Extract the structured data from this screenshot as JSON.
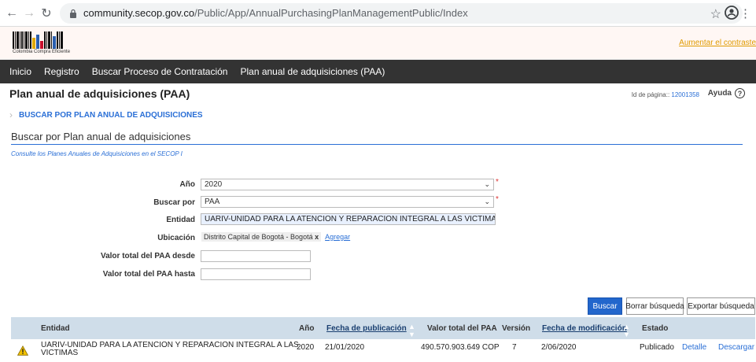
{
  "browser": {
    "back_icon": "arrow-left-icon",
    "forward_icon": "arrow-right-icon",
    "reload_icon": "reload-icon",
    "url_host": "community.secop.gov.co",
    "url_path": "/Public/App/AnnualPurchasingPlanManagementPublic/Index"
  },
  "header": {
    "logo_text": "Colombia Compra Eficiente",
    "font_size_link": "Aumentar el contraste"
  },
  "nav": {
    "items": [
      "Inicio",
      "Registro",
      "Buscar Proceso de Contratación",
      "Plan anual de adquisiciones (PAA)"
    ]
  },
  "page": {
    "title": "Plan anual de adquisiciones (PAA)",
    "page_id_label": "Id de página::",
    "page_id": "12001358",
    "help_label": "Ayuda",
    "breadcrumb": "BUSCAR POR PLAN ANUAL DE ADQUISICIONES",
    "section_title": "Buscar por Plan anual de adquisiciones",
    "subtitle": "Consulte los Planes Anuales de Adquisiciones en el SECOP I"
  },
  "form": {
    "year_label": "Año",
    "year_value": "2020",
    "search_by_label": "Buscar por",
    "search_by_value": "PAA",
    "entity_label": "Entidad",
    "entity_value": "UARIV-UNIDAD PARA LA ATENCION Y REPARACION INTEGRAL A LAS VICTIMAS",
    "location_label": "Ubicación",
    "location_value": "Distrito Capital de Bogotá - Bogotá",
    "location_remove": "x",
    "location_add": "Agregar",
    "from_label": "Valor total del PAA desde",
    "to_label": "Valor total del PAA hasta",
    "required_mark": "*"
  },
  "actions": {
    "search": "Buscar",
    "clear": "Borrar búsqueda",
    "export": "Exportar búsqueda"
  },
  "table": {
    "headers": {
      "entity": "Entidad",
      "year": "Año",
      "published": "Fecha de publicación",
      "total": "Valor total del PAA",
      "version": "Versión",
      "modified": "Fecha de modificación",
      "status": "Estado"
    },
    "rows": [
      {
        "entity_line1": "UARIV-UNIDAD PARA LA ATENCION Y REPARACION INTEGRAL A LAS",
        "entity_line2": "VICTIMAS",
        "year": "2020",
        "published": "21/01/2020",
        "total": "490.570.903.649 COP",
        "version": "7",
        "modified": "2/06/2020",
        "status": "Publicado",
        "detail": "Detalle",
        "download": "Descargar"
      }
    ]
  },
  "colors": {
    "accent": "#2a6fd6",
    "nav_bg": "#333333",
    "table_header_bg": "#cfdde9",
    "primary_button": "#2266cc"
  }
}
